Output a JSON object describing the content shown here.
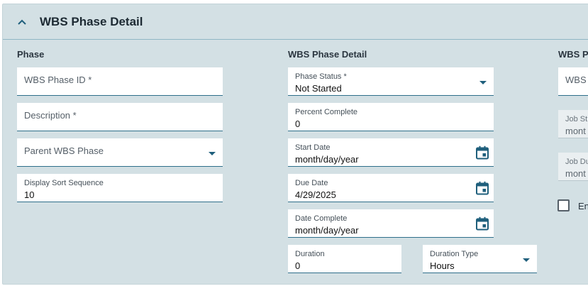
{
  "header": {
    "title": "WBS Phase Detail",
    "toggle_icon": "chevron-up-icon"
  },
  "phase_section": {
    "heading": "Phase",
    "wbs_phase_id": {
      "label": "WBS Phase ID *",
      "value": ""
    },
    "description": {
      "label": "Description *",
      "value": ""
    },
    "parent_wbs_phase": {
      "label": "Parent WBS Phase",
      "value": ""
    },
    "display_sort_sequence": {
      "label": "Display Sort Sequence",
      "value": "10"
    }
  },
  "detail_section": {
    "heading": "WBS Phase Detail",
    "phase_status": {
      "label": "Phase Status *",
      "value": "Not Started"
    },
    "percent_complete": {
      "label": "Percent Complete",
      "value": "0"
    },
    "start_date": {
      "label": "Start Date",
      "value": "month/day/year"
    },
    "due_date": {
      "label": "Due Date",
      "value": "4/29/2025"
    },
    "date_complete": {
      "label": "Date Complete",
      "value": "month/day/year"
    },
    "duration": {
      "label": "Duration",
      "value": "0"
    },
    "duration_type": {
      "label": "Duration Type",
      "value": "Hours"
    }
  },
  "third_section": {
    "heading": "WBS Ph",
    "wbs_job_field": {
      "label": "WBS J"
    },
    "job_status_field": {
      "label": "Job St",
      "value": "mont"
    },
    "job_due_field": {
      "label": "Job Du",
      "value": "mont"
    },
    "checkbox_label": "En",
    "checkbox_checked": false
  },
  "colors": {
    "panel_bg": "#d3e0e4",
    "accent": "#1f5f7c",
    "underline": "#2e6f8a"
  }
}
